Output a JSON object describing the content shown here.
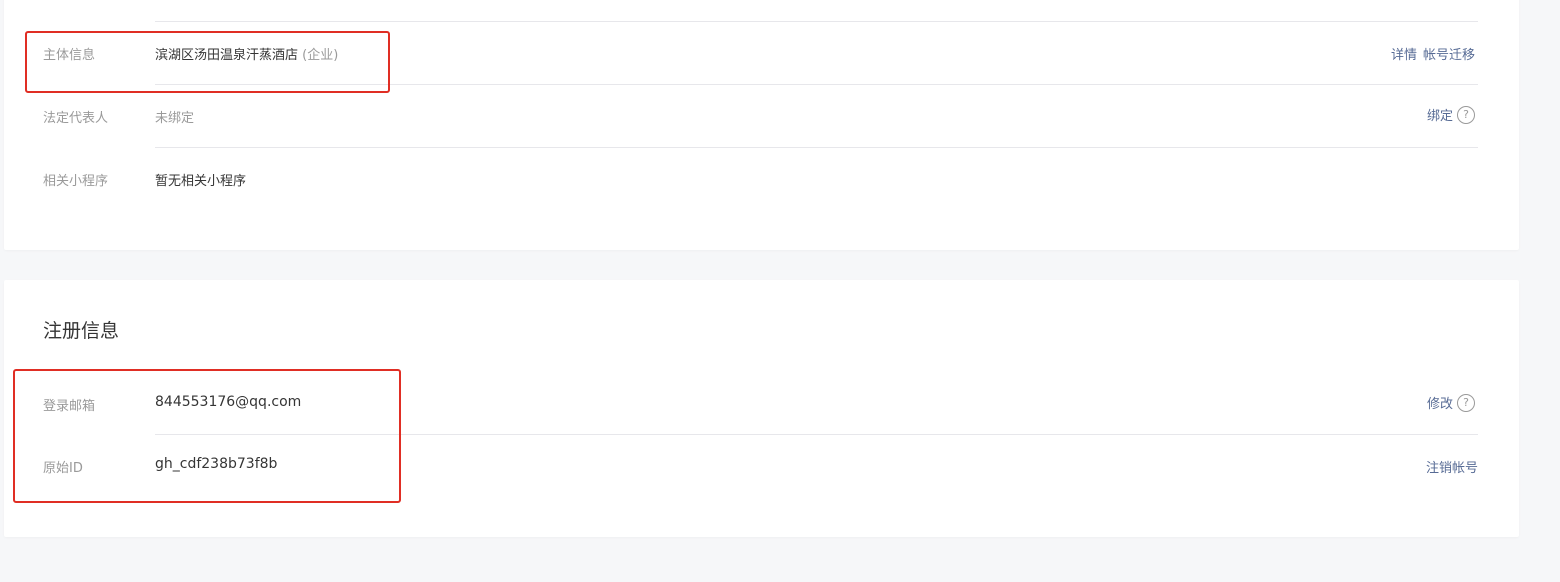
{
  "account_card": {
    "rows": [
      {
        "label": "主体信息",
        "value": "滨湖区汤田温泉汗蒸酒店",
        "tag": "(企业)",
        "actions": [
          "详情",
          "帐号迁移"
        ]
      },
      {
        "label": "法定代表人",
        "value": "未绑定",
        "actions": [
          "绑定"
        ]
      },
      {
        "label": "相关小程序",
        "value": "暂无相关小程序"
      }
    ]
  },
  "register_card": {
    "title": "注册信息",
    "rows": [
      {
        "label": "登录邮箱",
        "value": "844553176@qq.com",
        "actions": [
          "修改"
        ]
      },
      {
        "label": "原始ID",
        "value": "gh_cdf238b73f8b",
        "actions": [
          "注销帐号"
        ]
      }
    ]
  },
  "help_glyph": "?",
  "colors": {
    "link": "#576b95",
    "label": "#9a9a9a",
    "highlight": "#e02e24",
    "background": "#f6f7f9"
  }
}
